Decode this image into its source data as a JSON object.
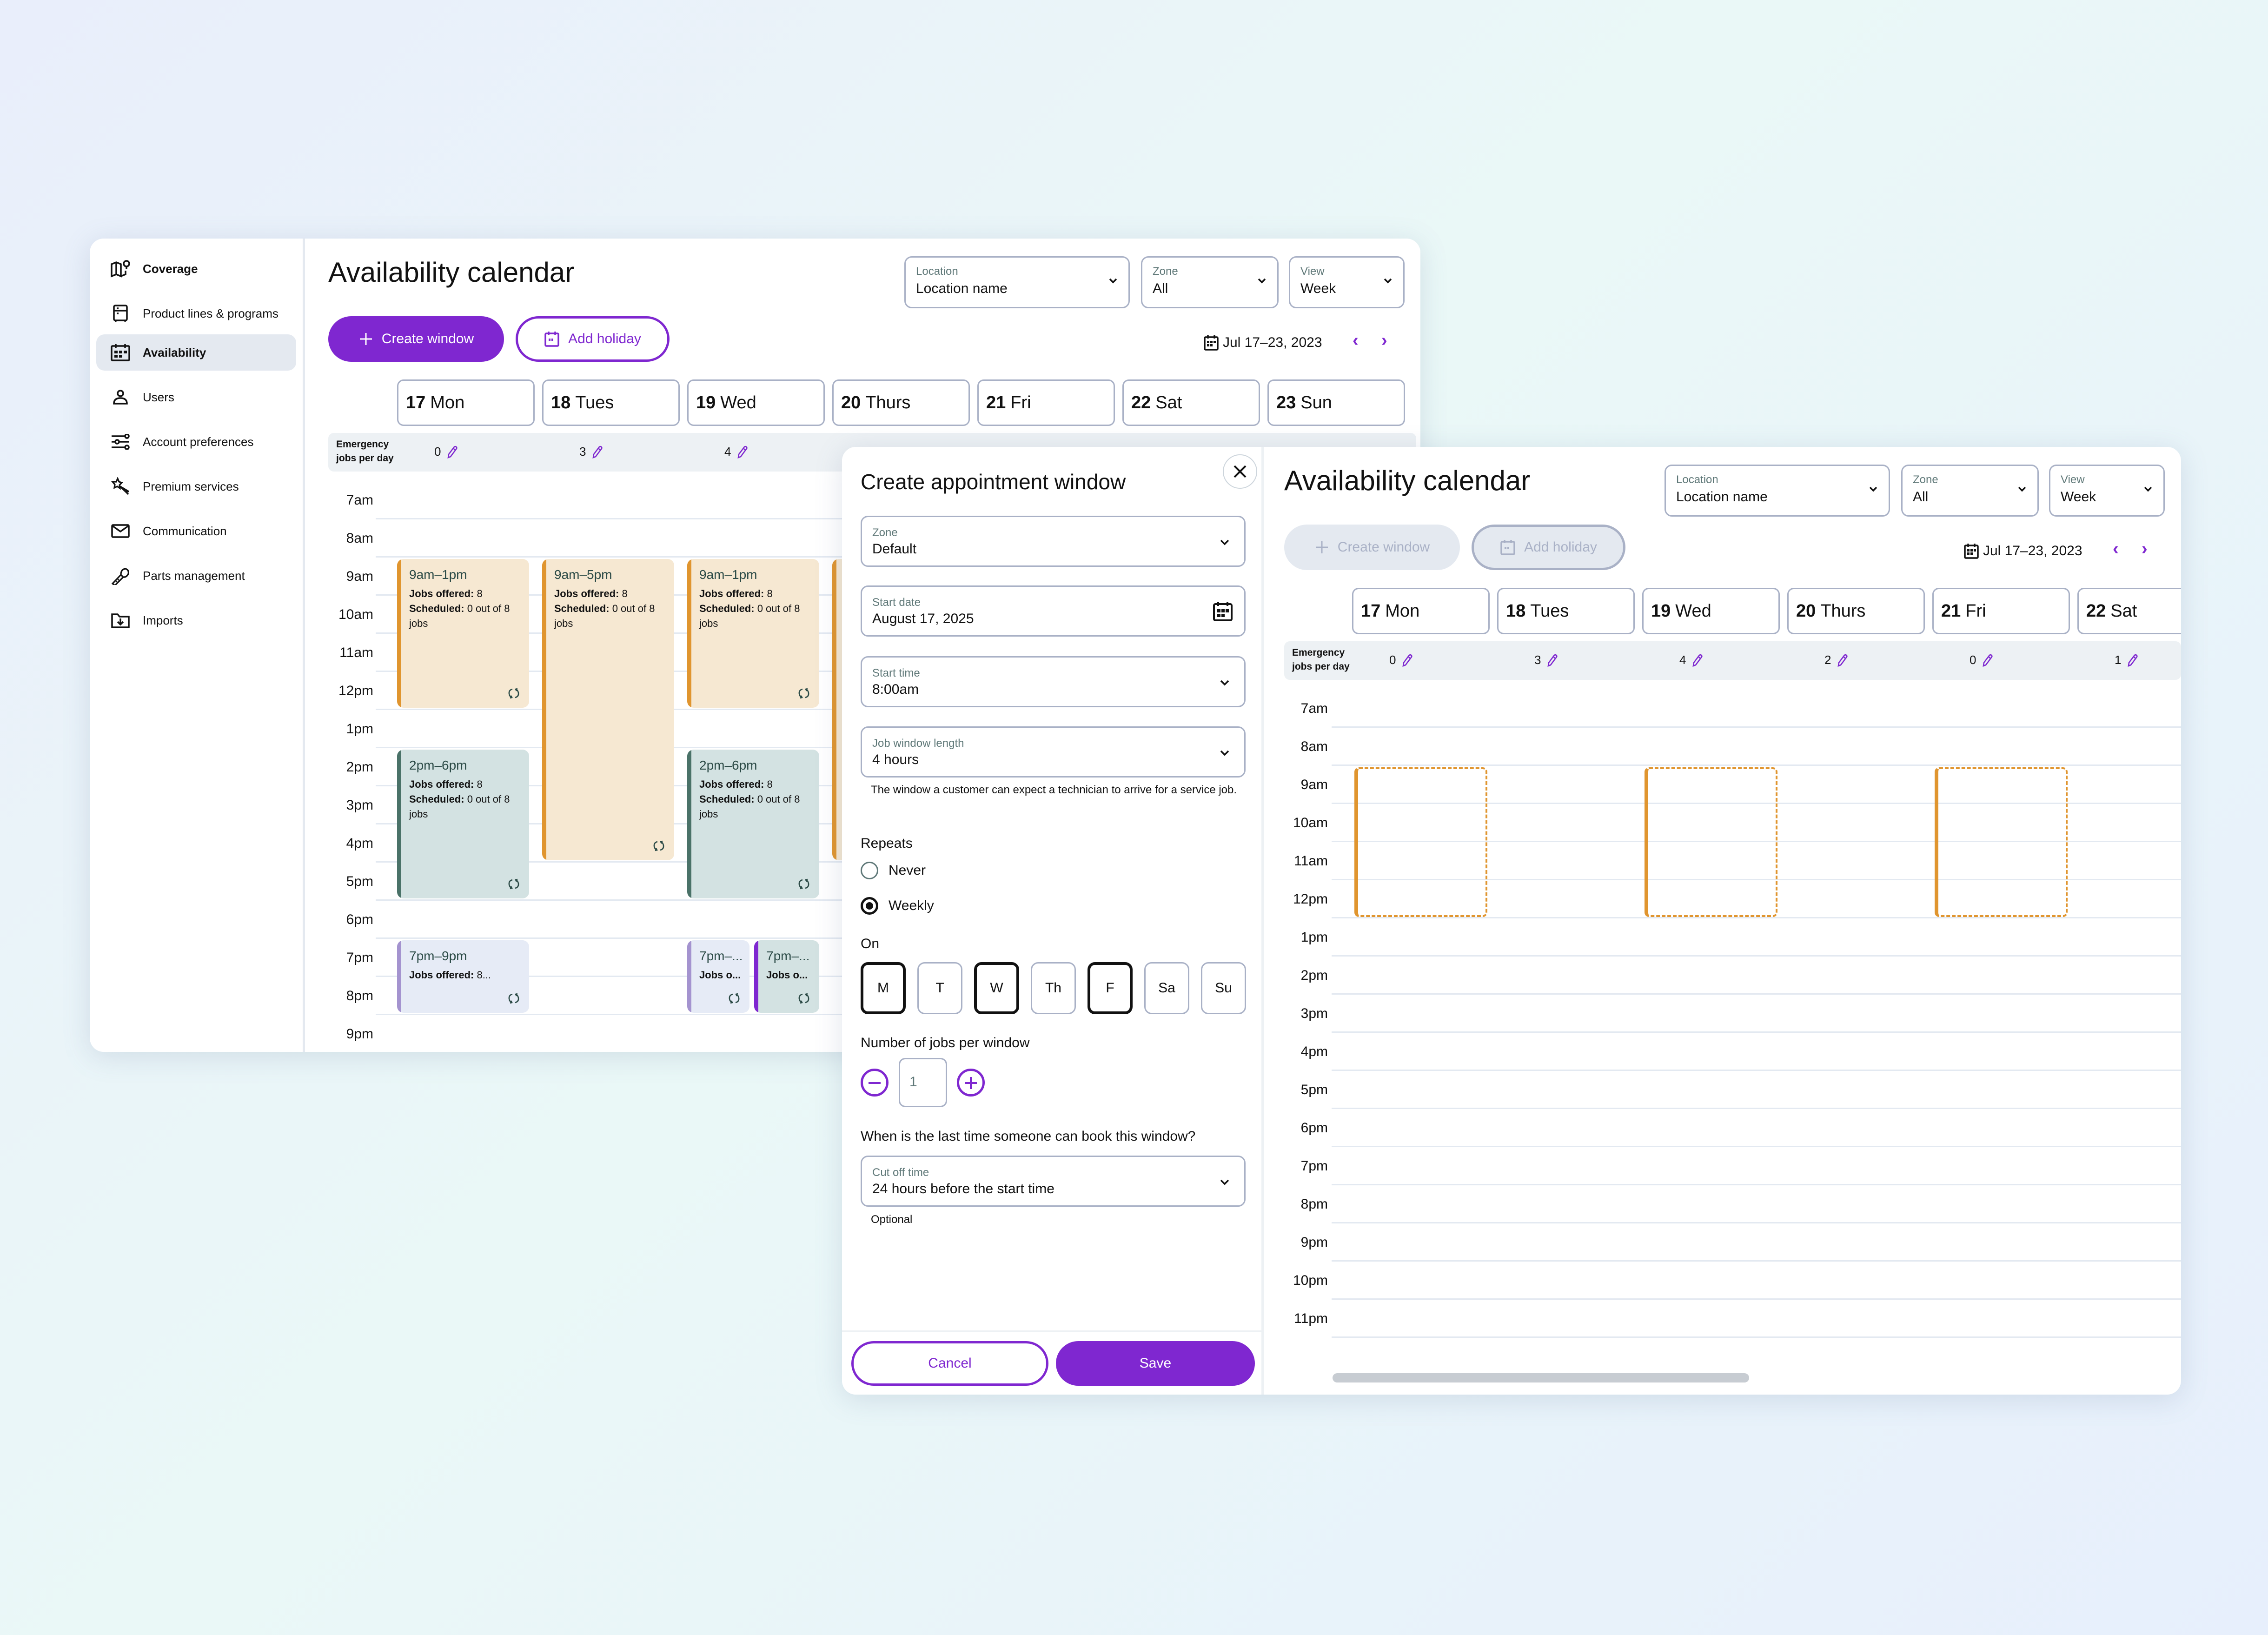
{
  "back_window": {
    "sidebar": {
      "items": [
        {
          "label": "Coverage",
          "icon": "map-pin-icon",
          "active": false
        },
        {
          "label": "Product lines & programs",
          "icon": "appliance-icon",
          "active": false
        },
        {
          "label": "Availability",
          "icon": "calendar-icon",
          "active": true
        },
        {
          "label": "Users",
          "icon": "user-icon",
          "active": false
        },
        {
          "label": "Account preferences",
          "icon": "sliders-icon",
          "active": false
        },
        {
          "label": "Premium services",
          "icon": "magic-wand-icon",
          "active": false
        },
        {
          "label": "Communication",
          "icon": "mail-icon",
          "active": false
        },
        {
          "label": "Parts management",
          "icon": "screw-icon",
          "active": false
        },
        {
          "label": "Imports",
          "icon": "folder-import-icon",
          "active": false
        }
      ]
    },
    "header": {
      "title": "Availability calendar",
      "location": {
        "label": "Location",
        "value": "Location name"
      },
      "zone": {
        "label": "Zone",
        "value": "All"
      },
      "view": {
        "label": "View",
        "value": "Week"
      },
      "create_window": "Create window",
      "add_holiday": "Add holiday",
      "date_range": "Jul 17–23, 2023",
      "prev": "‹",
      "next": "›"
    },
    "days": [
      {
        "num": "17",
        "name": "Mon"
      },
      {
        "num": "18",
        "name": "Tues"
      },
      {
        "num": "19",
        "name": "Wed"
      },
      {
        "num": "20",
        "name": "Thurs"
      },
      {
        "num": "21",
        "name": "Fri"
      },
      {
        "num": "22",
        "name": "Sat"
      },
      {
        "num": "23",
        "name": "Sun"
      }
    ],
    "emergency_label_1": "Emergency",
    "emergency_label_2": "jobs per day",
    "emergency_values": [
      "0",
      "3",
      "4"
    ],
    "hours": [
      "7am",
      "8am",
      "9am",
      "10am",
      "11am",
      "12pm",
      "1pm",
      "2pm",
      "3pm",
      "4pm",
      "5pm",
      "6pm",
      "7pm",
      "8pm",
      "9pm"
    ],
    "windows": [
      {
        "day": 0,
        "start": 9,
        "end": 13,
        "style": "orange",
        "time": "9am–1pm",
        "jobs_label": "Jobs offered:",
        "jobs": " 8",
        "sched_label": "Scheduled:",
        "sched": " 0 out of 8",
        "sched_2": "jobs"
      },
      {
        "day": 1,
        "start": 9,
        "end": 17,
        "style": "orange",
        "time": "9am–5pm",
        "jobs_label": "Jobs offered:",
        "jobs": " 8",
        "sched_label": "Scheduled:",
        "sched": " 0 out of 8",
        "sched_2": "jobs"
      },
      {
        "day": 2,
        "start": 9,
        "end": 13,
        "style": "orange",
        "time": "9am–1pm",
        "jobs_label": "Jobs offered:",
        "jobs": " 8",
        "sched_label": "Scheduled:",
        "sched": " 0 out of 8",
        "sched_2": "jobs"
      },
      {
        "day": 0,
        "start": 14,
        "end": 18,
        "style": "teal",
        "time": "2pm–6pm",
        "jobs_label": "Jobs offered:",
        "jobs": " 8",
        "sched_label": "Scheduled:",
        "sched": " 0 out of 8",
        "sched_2": "jobs"
      },
      {
        "day": 2,
        "start": 14,
        "end": 18,
        "style": "teal",
        "time": "2pm–6pm",
        "jobs_label": "Jobs offered:",
        "jobs": " 8",
        "sched_label": "Scheduled:",
        "sched": " 0 out of 8",
        "sched_2": "jobs"
      },
      {
        "day": 0,
        "start": 19,
        "end": 21,
        "style": "lav",
        "time": "7pm–9pm",
        "jobs_label": "Jobs offered:",
        "jobs": " 8...",
        "sched_label": "",
        "sched": "",
        "sched_2": ""
      },
      {
        "day": 2,
        "start": 19,
        "end": 21,
        "style": "lav",
        "half": "left",
        "time": "7pm–...",
        "jobs_label": "Jobs o...",
        "jobs": "",
        "sched_label": "",
        "sched": "",
        "sched_2": ""
      },
      {
        "day": 2,
        "start": 19,
        "end": 21,
        "style": "tealpurple",
        "half": "right",
        "time": "7pm–...",
        "jobs_label": "Jobs o...",
        "jobs": "",
        "sched_label": "",
        "sched": "",
        "sched_2": ""
      },
      {
        "day": 3,
        "start": 9,
        "end": 17,
        "style": "orange",
        "time": "",
        "jobs_label": "",
        "jobs": "",
        "sched_label": "",
        "sched": "",
        "sched_2": ""
      }
    ]
  },
  "modal": {
    "title": "Create appointment window",
    "zone": {
      "label": "Zone",
      "value": "Default"
    },
    "start_date": {
      "label": "Start date",
      "value": "August 17, 2025"
    },
    "start_time": {
      "label": "Start time",
      "value": "8:00am"
    },
    "window_length": {
      "label": "Job window length",
      "value": "4 hours"
    },
    "window_length_helper": "The window a customer can expect a technician to arrive for a service job.",
    "repeats_label": "Repeats",
    "repeat_options": [
      {
        "label": "Never",
        "selected": false
      },
      {
        "label": "Weekly",
        "selected": true
      }
    ],
    "on_label": "On",
    "weekdays": [
      {
        "label": "M",
        "selected": true
      },
      {
        "label": "T",
        "selected": false
      },
      {
        "label": "W",
        "selected": true
      },
      {
        "label": "Th",
        "selected": false
      },
      {
        "label": "F",
        "selected": true
      },
      {
        "label": "Sa",
        "selected": false
      },
      {
        "label": "Su",
        "selected": false
      }
    ],
    "jobs_per_window_label": "Number of jobs per window",
    "jobs_per_window_value": "1",
    "cutoff_question": "When is the last time someone can book this window?",
    "cutoff": {
      "label": "Cut off time",
      "value": "24 hours before the start time"
    },
    "cutoff_helper": "Optional",
    "cancel": "Cancel",
    "save": "Save"
  },
  "front_calendar": {
    "title": "Availability calendar",
    "location": {
      "label": "Location",
      "value": "Location name"
    },
    "zone": {
      "label": "Zone",
      "value": "All"
    },
    "view": {
      "label": "View",
      "value": "Week"
    },
    "create_window": "Create window",
    "add_holiday": "Add holiday",
    "date_range": "Jul 17–23, 2023",
    "prev": "‹",
    "next": "›",
    "days": [
      {
        "num": "17",
        "name": "Mon"
      },
      {
        "num": "18",
        "name": "Tues"
      },
      {
        "num": "19",
        "name": "Wed"
      },
      {
        "num": "20",
        "name": "Thurs"
      },
      {
        "num": "21",
        "name": "Fri"
      },
      {
        "num": "22",
        "name": "Sat"
      }
    ],
    "emergency_label_1": "Emergency",
    "emergency_label_2": "jobs per day",
    "emergency_values": [
      "0",
      "3",
      "4",
      "2",
      "0",
      "1"
    ],
    "hours": [
      "7am",
      "8am",
      "9am",
      "10am",
      "11am",
      "12pm",
      "1pm",
      "2pm",
      "3pm",
      "4pm",
      "5pm",
      "6pm",
      "7pm",
      "8pm",
      "9pm",
      "10pm",
      "11pm"
    ],
    "preview_windows": [
      {
        "day": 0,
        "start": 9,
        "end": 13
      },
      {
        "day": 2,
        "start": 9,
        "end": 13
      },
      {
        "day": 4,
        "start": 9,
        "end": 13
      }
    ]
  },
  "colors": {
    "accent": "#7f27d0",
    "window_orange": "#e0952f",
    "window_orange_bg": "#f6e8d2",
    "window_teal": "#4a7268",
    "window_teal_bg": "#d3e2e2",
    "window_lavender_bg": "#e6ebf6"
  }
}
